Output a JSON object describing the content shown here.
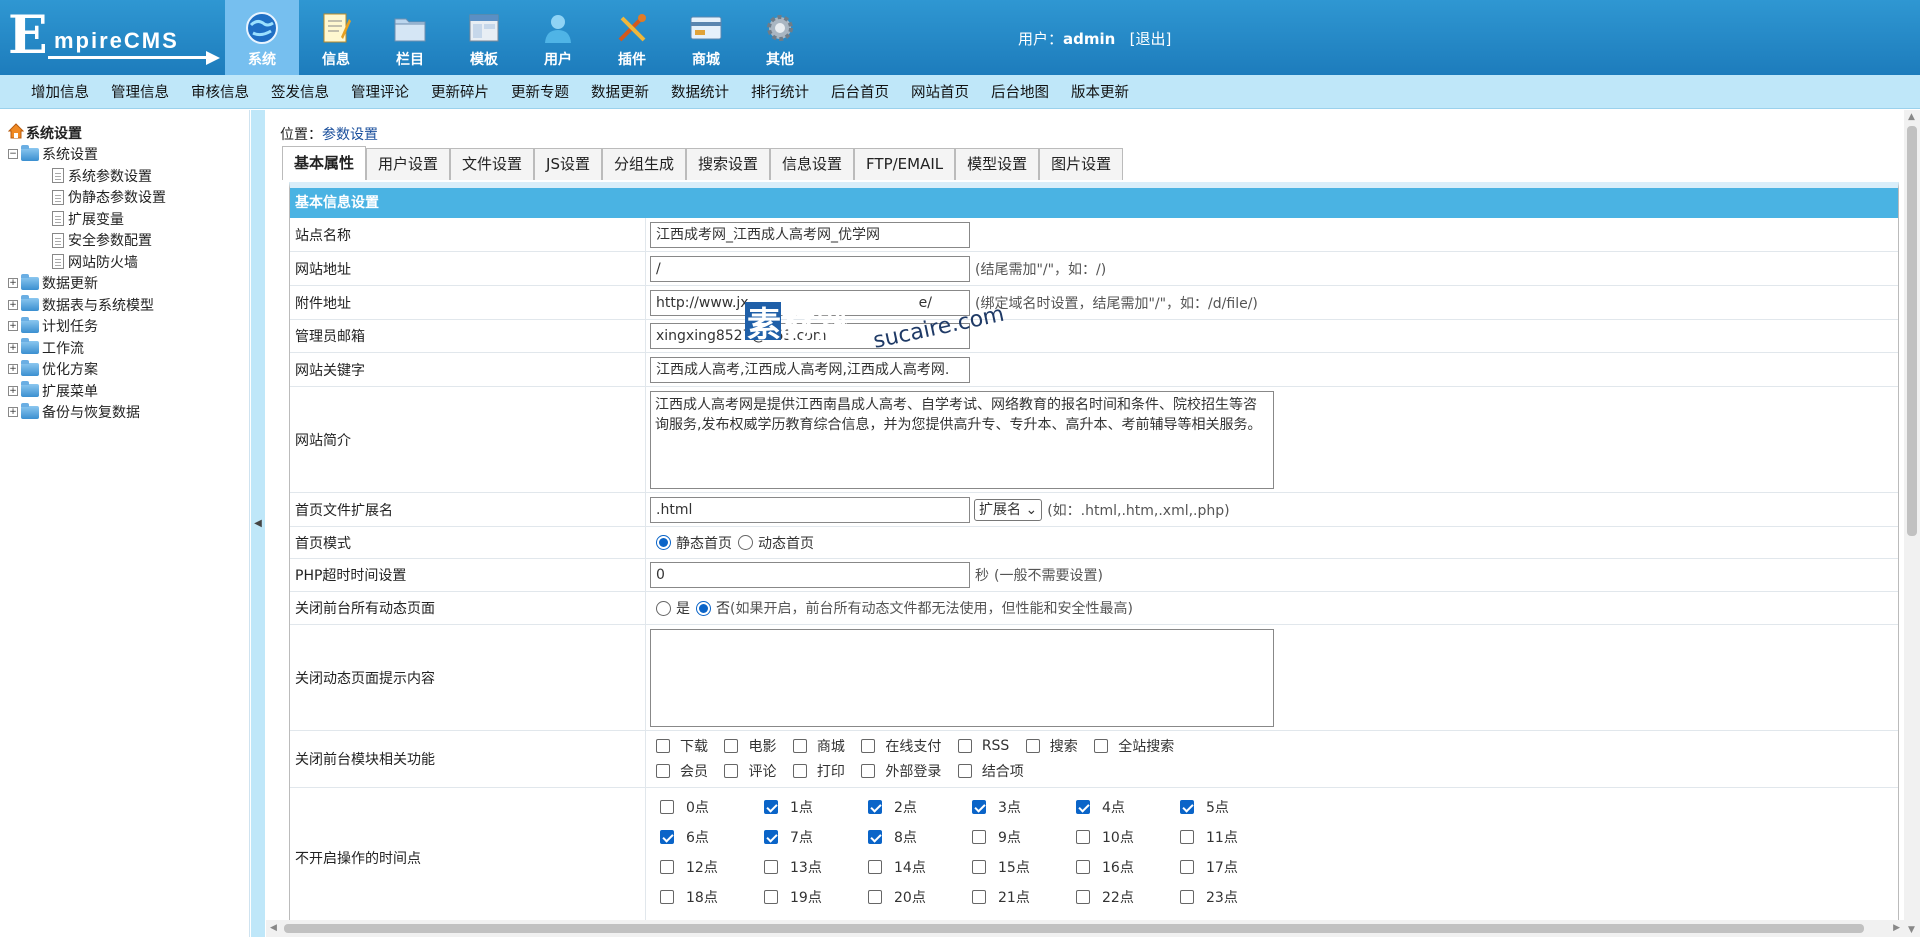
{
  "logo": {
    "first_letter": "E",
    "rest": "mpireCMS"
  },
  "top_nav": [
    {
      "label": "系统",
      "icon": "globe-icon",
      "active": true
    },
    {
      "label": "信息",
      "icon": "notepad-icon"
    },
    {
      "label": "栏目",
      "icon": "folder-icon"
    },
    {
      "label": "模板",
      "icon": "window-icon"
    },
    {
      "label": "用户",
      "icon": "user-icon"
    },
    {
      "label": "插件",
      "icon": "tools-icon"
    },
    {
      "label": "商城",
      "icon": "card-icon"
    },
    {
      "label": "其他",
      "icon": "gear-icon"
    }
  ],
  "user": {
    "prefix": "用户：",
    "name": "admin",
    "logout": "[退出]"
  },
  "sub_nav": [
    "增加信息",
    "管理信息",
    "审核信息",
    "签发信息",
    "管理评论",
    "更新碎片",
    "更新专题",
    "数据更新",
    "数据统计",
    "排行统计",
    "后台首页",
    "网站首页",
    "后台地图",
    "版本更新"
  ],
  "sidebar": {
    "root": "系统设置",
    "group": "系统设置",
    "children": [
      "系统参数设置",
      "伪静态参数设置",
      "扩展变量",
      "安全参数配置",
      "网站防火墙"
    ],
    "others": [
      "数据更新",
      "数据表与系统模型",
      "计划任务",
      "工作流",
      "优化方案",
      "扩展菜单",
      "备份与恢复数据"
    ]
  },
  "position": {
    "prefix": "位置：",
    "link": "参数设置"
  },
  "tabs": [
    "基本属性",
    "用户设置",
    "文件设置",
    "JS设置",
    "分组生成",
    "搜索设置",
    "信息设置",
    "FTP/EMAIL",
    "模型设置",
    "图片设置"
  ],
  "form": {
    "header": "基本信息设置",
    "site_name": {
      "label": "站点名称",
      "value": "江西成考网_江西成人高考网_优学网"
    },
    "site_url": {
      "label": "网站地址",
      "value": "/",
      "hint": "(结尾需加\"/\"，如：/)"
    },
    "attach_url": {
      "label": "附件地址",
      "value": "http://www.jx",
      "value_tail": "e/",
      "hint": "(绑定域名时设置，结尾需加\"/\"，如：/d/file/)"
    },
    "admin_email": {
      "label": "管理员邮箱",
      "value": "xingxing8527@163.com"
    },
    "keywords": {
      "label": "网站关键字",
      "value": "江西成人高考,江西成人高考网,江西成人高考网."
    },
    "intro": {
      "label": "网站简介",
      "value": "江西成人高考网是提供江西南昌成人高考、自学考试、网络教育的报名时间和条件、院校招生等咨询服务,发布权威学历教育综合信息，并为您提供高升专、专升本、高升本、考前辅导等相关服务。"
    },
    "index_ext": {
      "label": "首页文件扩展名",
      "value": ".html",
      "select": "扩展名",
      "hint": "(如：.html,.htm,.xml,.php)"
    },
    "index_mode": {
      "label": "首页模式",
      "opt1": "静态首页",
      "opt2": "动态首页"
    },
    "php_timeout": {
      "label": "PHP超时时间设置",
      "value": "0",
      "unit": "秒",
      "hint": "(一般不需要设置)"
    },
    "close_dynamic": {
      "label": "关闭前台所有动态页面",
      "opt_yes": "是",
      "opt_no": "否",
      "hint": "(如果开启，前台所有动态文件都无法使用，但性能和安全性最高)"
    },
    "close_tip": {
      "label": "关闭动态页面提示内容",
      "value": ""
    },
    "close_modules": {
      "label": "关闭前台模块相关功能",
      "row1": [
        "下载",
        "电影",
        "商城",
        "在线支付",
        "RSS",
        "搜索",
        "全站搜索"
      ],
      "row2": [
        "会员",
        "评论",
        "打印",
        "外部登录",
        "结合项"
      ]
    },
    "hours": {
      "label": "不开启操作的时间点",
      "items": [
        "0点",
        "1点",
        "2点",
        "3点",
        "4点",
        "5点",
        "6点",
        "7点",
        "8点",
        "9点",
        "10点",
        "11点",
        "12点",
        "13点",
        "14点",
        "15点",
        "16点",
        "17点",
        "18点",
        "19点",
        "20点",
        "21点",
        "22点",
        "23点"
      ],
      "checked": [
        false,
        true,
        true,
        true,
        true,
        true,
        true,
        true,
        true,
        false,
        false,
        false,
        false,
        false,
        false,
        false,
        false,
        false,
        false,
        false,
        false,
        false,
        false,
        false
      ]
    }
  },
  "watermark": {
    "cn": "素材熟",
    "en": "sucaire.com"
  }
}
